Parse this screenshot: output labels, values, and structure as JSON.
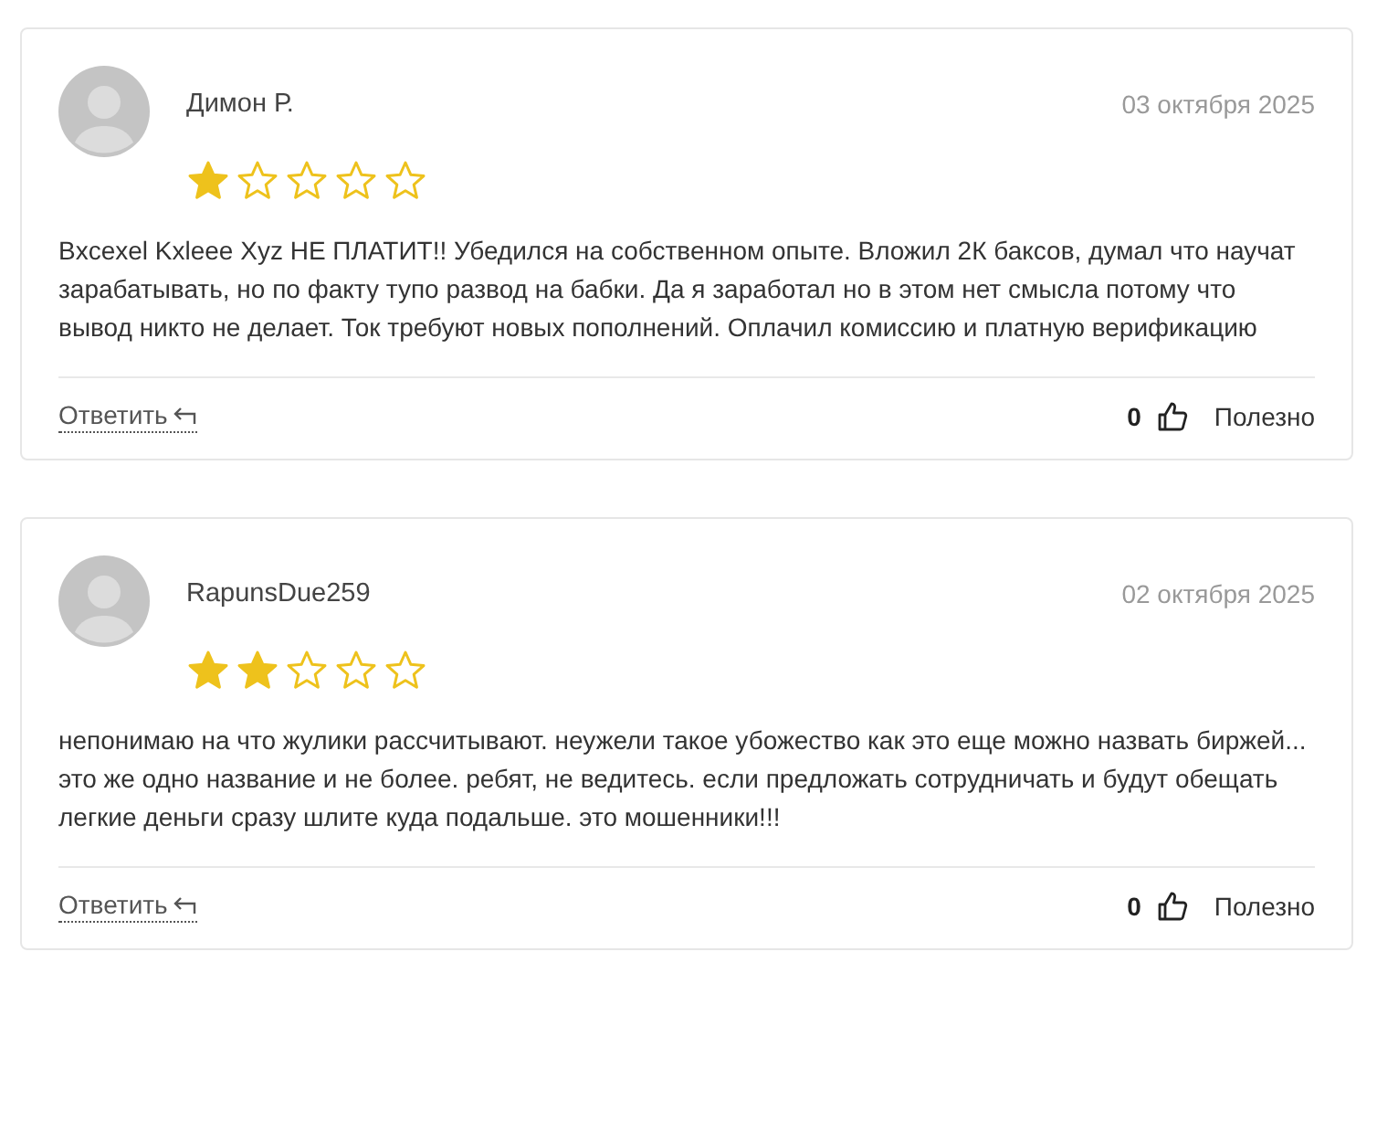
{
  "reviews": [
    {
      "author": "Димон Р.",
      "date": "03 октября 2025",
      "stars": 1,
      "text": "Bxcexel Kxleee Xyz НЕ ПЛАТИТ!! Убедился на собственном опыте. Вложил 2К баксов, думал что научат зарабатывать, но по факту тупо развод на бабки. Да я заработал но в этом нет смысла потому что вывод никто не делает. Ток требуют новых пополнений. Оплачил комиссию и платную верификацию",
      "reply": "Ответить",
      "likes": "0",
      "helpful": "Полезно"
    },
    {
      "author": "RapunsDue259",
      "date": "02 октября 2025",
      "stars": 2,
      "text": "непонимаю на что жулики рассчитывают. неужели такое убожество как это еще можно назвать биржей... это же одно название и не более. ребят, не ведитесь. если предложать сотрудничать и будут обещать легкие деньги сразу шлите куда подальше. это мошенники!!!",
      "reply": "Ответить",
      "likes": "0",
      "helpful": "Полезно"
    }
  ]
}
